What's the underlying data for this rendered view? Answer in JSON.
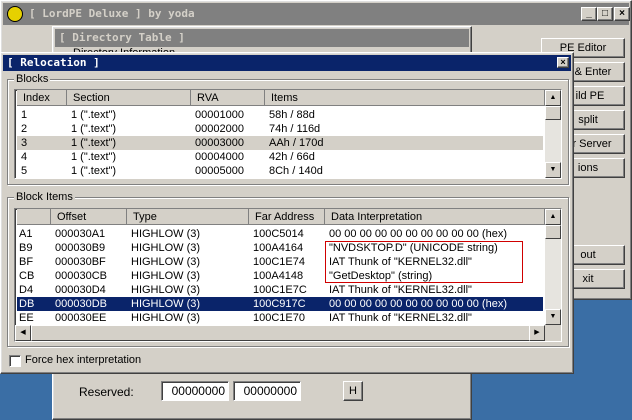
{
  "main_window": {
    "title": "[ LordPE Deluxe ] by yoda",
    "buttons": [
      "PE Editor",
      "& Enter",
      "ild PE",
      "split",
      "r Server",
      "ions",
      "out",
      "xit"
    ]
  },
  "dir_table": {
    "title": "[ Directory Table ]",
    "partial_label": "Directory Information",
    "reserved_label": "Reserved:",
    "reserved_values": [
      "00000000",
      "00000000"
    ],
    "h_button": "H"
  },
  "relocation": {
    "title": "[ Relocation ]",
    "blocks_label": "Blocks",
    "blocks_columns": [
      "Index",
      "Section",
      "RVA",
      "Items"
    ],
    "blocks_rows": [
      [
        "1",
        "1 (\".text\")",
        "00001000",
        "58h / 88d"
      ],
      [
        "2",
        "1 (\".text\")",
        "00002000",
        "74h / 116d"
      ],
      [
        "3",
        "1 (\".text\")",
        "00003000",
        "AAh / 170d"
      ],
      [
        "4",
        "1 (\".text\")",
        "00004000",
        "42h / 66d"
      ],
      [
        "5",
        "1 (\".text\")",
        "00005000",
        "8Ch / 140d"
      ]
    ],
    "block_items_label": "Block Items",
    "items_columns": [
      "",
      "Offset",
      "Type",
      "Far Address",
      "Data Interpretation"
    ],
    "items_rows": [
      [
        "A1",
        "000030A1",
        "HIGHLOW (3)",
        "100C5014",
        "00 00 00 00 00 00 00 00 00 00  (hex)"
      ],
      [
        "B9",
        "000030B9",
        "HIGHLOW (3)",
        "100A4164",
        "\"NVDSKTOP.D\" (UNICODE string)"
      ],
      [
        "BF",
        "000030BF",
        "HIGHLOW (3)",
        "100C1E74",
        "IAT Thunk of \"KERNEL32.dll\""
      ],
      [
        "CB",
        "000030CB",
        "HIGHLOW (3)",
        "100A4148",
        "\"GetDesktop\" (string)"
      ],
      [
        "D4",
        "000030D4",
        "HIGHLOW (3)",
        "100C1E7C",
        "IAT Thunk of \"KERNEL32.dll\""
      ],
      [
        "DB",
        "000030DB",
        "HIGHLOW (3)",
        "100C917C",
        "00 00 00 00 00 00 00 00 00 00  (hex)"
      ],
      [
        "EE",
        "000030EE",
        "HIGHLOW (3)",
        "100C1E70",
        "IAT Thunk of \"KERNEL32.dll\""
      ]
    ],
    "force_hex_label": "Force hex interpretation"
  },
  "colors": {
    "title_active": "#0a246a",
    "title_inactive": "#808080",
    "selection": "#0a246a",
    "highlight_box": "#d00000"
  },
  "icons": [
    "lordpe-logo-icon",
    "minimize-icon",
    "maximize-icon",
    "close-icon",
    "scroll-up-icon",
    "scroll-down-icon",
    "scroll-left-icon",
    "scroll-right-icon"
  ]
}
